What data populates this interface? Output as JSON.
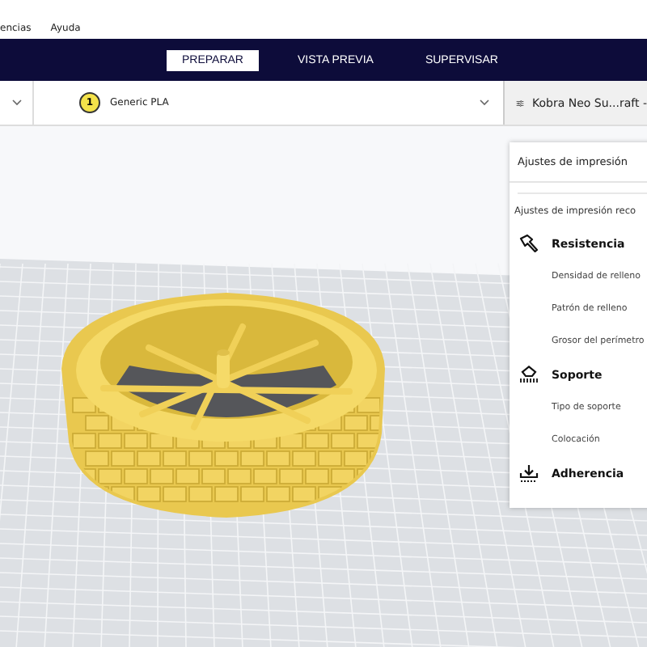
{
  "menu": [
    "encias",
    "Ayuda"
  ],
  "tabs": [
    {
      "label": "PREPARAR",
      "selected": true
    },
    {
      "label": "VISTA PREVIA",
      "selected": false
    },
    {
      "label": "SUPERVISAR",
      "selected": false
    }
  ],
  "material": {
    "badge": "1",
    "name": "Generic PLA"
  },
  "printer_profile": "Kobra Neo Su...raft -",
  "viewport": {
    "kind": "model-view"
  },
  "settings_panel": {
    "title": "Ajustes de impresión",
    "subtitle": "Ajustes de impresión reco",
    "sections": [
      {
        "kind": "strength",
        "label": "Resistencia",
        "items": [
          "Densidad de relleno",
          "Patrón de relleno",
          "Grosor del perímetro"
        ]
      },
      {
        "kind": "support",
        "label": "Soporte",
        "items": [
          "Tipo de soporte",
          "Colocación"
        ]
      },
      {
        "kind": "adhesion",
        "label": "Adherencia"
      }
    ]
  }
}
